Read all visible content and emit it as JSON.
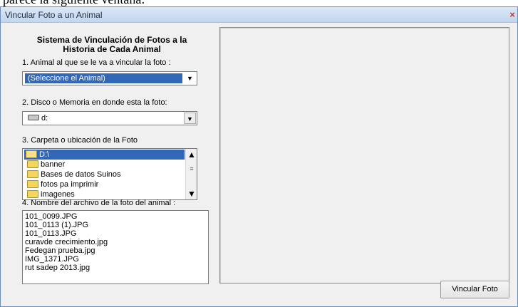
{
  "background_text": "parece la siguiente ventana:",
  "window": {
    "title": "Vincular Foto a un Animal",
    "close_glyph": "×"
  },
  "heading": {
    "line1": "Sistema de Vinculación de Fotos a la",
    "line2": "Historia de Cada Animal"
  },
  "step1": {
    "label": "1. Animal al que se le va a vincular la foto :",
    "value": "(Seleccione el Animal)",
    "arrow": "▼"
  },
  "step2": {
    "label": "2. Disco o Memoria en donde esta la foto:",
    "value": "d:",
    "arrow": "▼"
  },
  "step3": {
    "label": "3. Carpeta o ubicación de la Foto",
    "folders": [
      "D:\\",
      "banner",
      "Bases de datos Suinos",
      "fotos pa imprimir",
      "imagenes"
    ],
    "scroll_up": "▲",
    "scroll_down": "▼",
    "scroll_grip": "≡"
  },
  "step4": {
    "label": "4. Nombre del archivo de la foto del animal :",
    "files": [
      "101_0099.JPG",
      "101_0113 (1).JPG",
      "101_0113.JPG",
      "curavde crecimiento.jpg",
      "Fedegan prueba.jpg",
      "IMG_1371.JPG",
      "rut sadep 2013.jpg"
    ]
  },
  "actions": {
    "link_label": "Vincular Foto"
  },
  "colors": {
    "selection": "#3266b7",
    "window_bg": "#f0f0f0",
    "titlebar": "#c2d6ee"
  }
}
